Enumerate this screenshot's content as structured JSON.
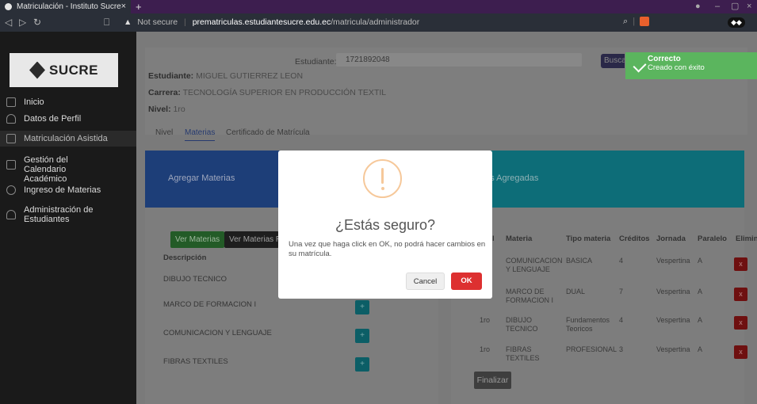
{
  "browser": {
    "tab_title": "Matriculación - Instituto Sucre",
    "url_warning": "Not secure",
    "url_host": "prematriculas.estudiantesucre.edu.ec",
    "url_path": "/matricula/administrador"
  },
  "sidebar": {
    "logo_text": "SUCRE",
    "items": [
      {
        "label": "Inicio"
      },
      {
        "label": "Datos de Perfil"
      },
      {
        "label": "Matriculación Asistida"
      },
      {
        "label": "Gestión del Calendario Académico"
      },
      {
        "label": "Ingreso de Materias"
      },
      {
        "label": "Administración de Estudiantes"
      }
    ]
  },
  "student": {
    "search_label": "Estudiante:",
    "search_value": "1721892048",
    "search_button": "Buscar",
    "name_label": "Estudiante:",
    "name": "MIGUEL GUTIERREZ LEON",
    "career_label": "Carrera:",
    "career": "TECNOLOGÍA SUPERIOR EN PRODUCCIÓN TEXTIL",
    "level_label": "Nivel:",
    "level": "1ro"
  },
  "tabs": [
    "Nivel",
    "Materias",
    "Certificado de Matrícula"
  ],
  "left_panel": {
    "title": "Agregar Materias",
    "btn_ver_materias": "Ver Materias",
    "btn_ver_materias_r": "Ver Materias R",
    "col_descripcion": "Descripción",
    "subjects": [
      "DIBUJO TECNICO",
      "MARCO DE FORMACION I",
      "COMUNICACION Y LENGUAJE",
      "FIBRAS TEXTILES"
    ],
    "add_symbol": "+"
  },
  "right_panel": {
    "title": "rias Agregadas",
    "columns": [
      "l",
      "Materia",
      "Tipo materia",
      "Créditos",
      "Jornada",
      "Paralelo",
      "Elimina"
    ],
    "rows": [
      {
        "nivel": "",
        "materia": "COMUNICACION Y LENGUAJE",
        "tipo": "BASICA",
        "creditos": "4",
        "jornada": "Vespertina",
        "paralelo": "A"
      },
      {
        "nivel": "",
        "materia": "MARCO DE FORMACION I",
        "tipo": "DUAL",
        "creditos": "7",
        "jornada": "Vespertina",
        "paralelo": "A"
      },
      {
        "nivel": "1ro",
        "materia": "DIBUJO TECNICO",
        "tipo": "Fundamentos Teoricos",
        "creditos": "4",
        "jornada": "Vespertina",
        "paralelo": "A"
      },
      {
        "nivel": "1ro",
        "materia": "FIBRAS TEXTILES",
        "tipo": "PROFESIONAL",
        "creditos": "3",
        "jornada": "Vespertina",
        "paralelo": "A"
      }
    ],
    "delete_symbol": "x",
    "finalize_button": "Finalizar"
  },
  "toast": {
    "title": "Correcto",
    "message": "Creado con éxito",
    "color": "#5bb55e"
  },
  "modal": {
    "title": "¿Estás seguro?",
    "text": "Una vez que haga click en OK, no podrá hacer cambios en su matrícula.",
    "cancel_label": "Cancel",
    "ok_label": "OK",
    "ok_color": "#dd3030"
  }
}
